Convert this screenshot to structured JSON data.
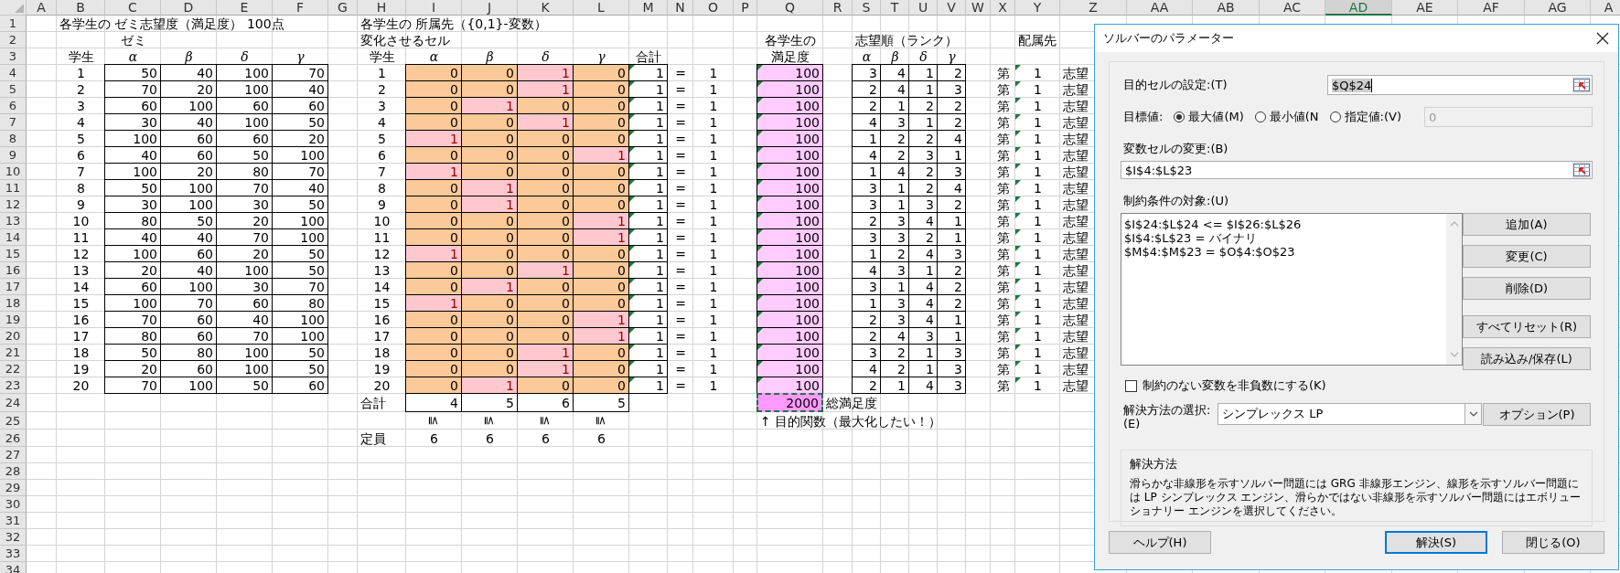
{
  "sheet": {
    "columns": [
      {
        "label": "A",
        "selected": false
      },
      {
        "label": "B",
        "selected": false
      },
      {
        "label": "C",
        "selected": false
      },
      {
        "label": "D",
        "selected": false
      },
      {
        "label": "E",
        "selected": false
      },
      {
        "label": "F",
        "selected": false
      },
      {
        "label": "G",
        "selected": false
      },
      {
        "label": "H",
        "selected": false
      },
      {
        "label": "I",
        "selected": false
      },
      {
        "label": "J",
        "selected": false
      },
      {
        "label": "K",
        "selected": false
      },
      {
        "label": "L",
        "selected": false
      },
      {
        "label": "M",
        "selected": false
      },
      {
        "label": "N",
        "selected": false
      },
      {
        "label": "O",
        "selected": false
      },
      {
        "label": "P",
        "selected": false
      },
      {
        "label": "Q",
        "selected": false
      },
      {
        "label": "R",
        "selected": false
      },
      {
        "label": "S",
        "selected": false
      },
      {
        "label": "T",
        "selected": false
      },
      {
        "label": "U",
        "selected": false
      },
      {
        "label": "V",
        "selected": false
      },
      {
        "label": "W",
        "selected": false
      },
      {
        "label": "X",
        "selected": false
      },
      {
        "label": "Y",
        "selected": false
      },
      {
        "label": "Z",
        "selected": false
      },
      {
        "label": "AA",
        "selected": false
      },
      {
        "label": "AB",
        "selected": false
      },
      {
        "label": "AC",
        "selected": false
      },
      {
        "label": "AD",
        "selected": true
      },
      {
        "label": "AE",
        "selected": false
      },
      {
        "label": "AF",
        "selected": false
      },
      {
        "label": "AG",
        "selected": false
      },
      {
        "label": "A",
        "selected": false
      }
    ],
    "rows": [
      "1",
      "2",
      "3",
      "4",
      "5",
      "6",
      "7",
      "8",
      "9",
      "10",
      "11",
      "12",
      "13",
      "14",
      "15",
      "16",
      "17",
      "18",
      "19",
      "20",
      "21",
      "22",
      "23",
      "24",
      "25",
      "26",
      "27",
      "28",
      "29",
      "30",
      "31",
      "32",
      "33",
      "34"
    ]
  },
  "preferences": {
    "title": "各学生の ゼミ志望度（満足度） 100点",
    "group_label": "ゼミ",
    "student_header": "学生",
    "seminar_headers": [
      "α",
      "β",
      "δ",
      "γ"
    ],
    "rows": [
      {
        "student": "1",
        "scores": [
          "50",
          "40",
          "100",
          "70"
        ]
      },
      {
        "student": "2",
        "scores": [
          "70",
          "20",
          "100",
          "40"
        ]
      },
      {
        "student": "3",
        "scores": [
          "60",
          "100",
          "60",
          "60"
        ]
      },
      {
        "student": "4",
        "scores": [
          "30",
          "40",
          "100",
          "50"
        ]
      },
      {
        "student": "5",
        "scores": [
          "100",
          "60",
          "60",
          "20"
        ]
      },
      {
        "student": "6",
        "scores": [
          "40",
          "60",
          "50",
          "100"
        ]
      },
      {
        "student": "7",
        "scores": [
          "100",
          "20",
          "80",
          "70"
        ]
      },
      {
        "student": "8",
        "scores": [
          "50",
          "100",
          "70",
          "40"
        ]
      },
      {
        "student": "9",
        "scores": [
          "30",
          "100",
          "30",
          "50"
        ]
      },
      {
        "student": "10",
        "scores": [
          "80",
          "50",
          "20",
          "100"
        ]
      },
      {
        "student": "11",
        "scores": [
          "40",
          "40",
          "70",
          "100"
        ]
      },
      {
        "student": "12",
        "scores": [
          "100",
          "60",
          "20",
          "50"
        ]
      },
      {
        "student": "13",
        "scores": [
          "20",
          "40",
          "100",
          "50"
        ]
      },
      {
        "student": "14",
        "scores": [
          "60",
          "100",
          "30",
          "70"
        ]
      },
      {
        "student": "15",
        "scores": [
          "100",
          "70",
          "60",
          "80"
        ]
      },
      {
        "student": "16",
        "scores": [
          "70",
          "60",
          "40",
          "100"
        ]
      },
      {
        "student": "17",
        "scores": [
          "80",
          "60",
          "70",
          "100"
        ]
      },
      {
        "student": "18",
        "scores": [
          "50",
          "80",
          "100",
          "50"
        ]
      },
      {
        "student": "19",
        "scores": [
          "20",
          "60",
          "100",
          "50"
        ]
      },
      {
        "student": "20",
        "scores": [
          "70",
          "100",
          "50",
          "60"
        ]
      }
    ]
  },
  "assignment": {
    "title": "各学生の 所属先（{0,1}-変数）",
    "subtitle": "変化させるセル",
    "student_header": "学生",
    "seminar_headers": [
      "α",
      "β",
      "δ",
      "γ"
    ],
    "sum_header": "合計",
    "rows": [
      {
        "student": "1",
        "values": [
          {
            "value": "0",
            "highlighted": false
          },
          {
            "value": "0",
            "highlighted": false
          },
          {
            "value": "1",
            "highlighted": true
          },
          {
            "value": "0",
            "highlighted": false
          }
        ],
        "sum": "1",
        "sum_flagged": true,
        "relation": "=",
        "target": "1"
      },
      {
        "student": "2",
        "values": [
          {
            "value": "0",
            "highlighted": false
          },
          {
            "value": "0",
            "highlighted": false
          },
          {
            "value": "1",
            "highlighted": true
          },
          {
            "value": "0",
            "highlighted": false
          }
        ],
        "sum": "1",
        "sum_flagged": true,
        "relation": "=",
        "target": "1"
      },
      {
        "student": "3",
        "values": [
          {
            "value": "0",
            "highlighted": false
          },
          {
            "value": "1",
            "highlighted": true
          },
          {
            "value": "0",
            "highlighted": false
          },
          {
            "value": "0",
            "highlighted": false
          }
        ],
        "sum": "1",
        "sum_flagged": true,
        "relation": "=",
        "target": "1"
      },
      {
        "student": "4",
        "values": [
          {
            "value": "0",
            "highlighted": false
          },
          {
            "value": "0",
            "highlighted": false
          },
          {
            "value": "1",
            "highlighted": true
          },
          {
            "value": "0",
            "highlighted": false
          }
        ],
        "sum": "1",
        "sum_flagged": true,
        "relation": "=",
        "target": "1"
      },
      {
        "student": "5",
        "values": [
          {
            "value": "1",
            "highlighted": true
          },
          {
            "value": "0",
            "highlighted": false
          },
          {
            "value": "0",
            "highlighted": false
          },
          {
            "value": "0",
            "highlighted": false
          }
        ],
        "sum": "1",
        "sum_flagged": true,
        "relation": "=",
        "target": "1"
      },
      {
        "student": "6",
        "values": [
          {
            "value": "0",
            "highlighted": false
          },
          {
            "value": "0",
            "highlighted": false
          },
          {
            "value": "0",
            "highlighted": false
          },
          {
            "value": "1",
            "highlighted": true
          }
        ],
        "sum": "1",
        "sum_flagged": true,
        "relation": "=",
        "target": "1"
      },
      {
        "student": "7",
        "values": [
          {
            "value": "1",
            "highlighted": true
          },
          {
            "value": "0",
            "highlighted": false
          },
          {
            "value": "0",
            "highlighted": false
          },
          {
            "value": "0",
            "highlighted": false
          }
        ],
        "sum": "1",
        "sum_flagged": true,
        "relation": "=",
        "target": "1"
      },
      {
        "student": "8",
        "values": [
          {
            "value": "0",
            "highlighted": false
          },
          {
            "value": "1",
            "highlighted": true
          },
          {
            "value": "0",
            "highlighted": false
          },
          {
            "value": "0",
            "highlighted": false
          }
        ],
        "sum": "1",
        "sum_flagged": true,
        "relation": "=",
        "target": "1"
      },
      {
        "student": "9",
        "values": [
          {
            "value": "0",
            "highlighted": false
          },
          {
            "value": "1",
            "highlighted": true
          },
          {
            "value": "0",
            "highlighted": false
          },
          {
            "value": "0",
            "highlighted": false
          }
        ],
        "sum": "1",
        "sum_flagged": true,
        "relation": "=",
        "target": "1"
      },
      {
        "student": "10",
        "values": [
          {
            "value": "0",
            "highlighted": false
          },
          {
            "value": "0",
            "highlighted": false
          },
          {
            "value": "0",
            "highlighted": false
          },
          {
            "value": "1",
            "highlighted": true
          }
        ],
        "sum": "1",
        "sum_flagged": true,
        "relation": "=",
        "target": "1"
      },
      {
        "student": "11",
        "values": [
          {
            "value": "0",
            "highlighted": false
          },
          {
            "value": "0",
            "highlighted": false
          },
          {
            "value": "0",
            "highlighted": false
          },
          {
            "value": "1",
            "highlighted": true
          }
        ],
        "sum": "1",
        "sum_flagged": true,
        "relation": "=",
        "target": "1"
      },
      {
        "student": "12",
        "values": [
          {
            "value": "1",
            "highlighted": true
          },
          {
            "value": "0",
            "highlighted": false
          },
          {
            "value": "0",
            "highlighted": false
          },
          {
            "value": "0",
            "highlighted": false
          }
        ],
        "sum": "1",
        "sum_flagged": true,
        "relation": "=",
        "target": "1"
      },
      {
        "student": "13",
        "values": [
          {
            "value": "0",
            "highlighted": false
          },
          {
            "value": "0",
            "highlighted": false
          },
          {
            "value": "1",
            "highlighted": true
          },
          {
            "value": "0",
            "highlighted": false
          }
        ],
        "sum": "1",
        "sum_flagged": true,
        "relation": "=",
        "target": "1"
      },
      {
        "student": "14",
        "values": [
          {
            "value": "0",
            "highlighted": false
          },
          {
            "value": "1",
            "highlighted": true
          },
          {
            "value": "0",
            "highlighted": false
          },
          {
            "value": "0",
            "highlighted": false
          }
        ],
        "sum": "1",
        "sum_flagged": true,
        "relation": "=",
        "target": "1"
      },
      {
        "student": "15",
        "values": [
          {
            "value": "1",
            "highlighted": true
          },
          {
            "value": "0",
            "highlighted": false
          },
          {
            "value": "0",
            "highlighted": false
          },
          {
            "value": "0",
            "highlighted": false
          }
        ],
        "sum": "1",
        "sum_flagged": true,
        "relation": "=",
        "target": "1"
      },
      {
        "student": "16",
        "values": [
          {
            "value": "0",
            "highlighted": false
          },
          {
            "value": "0",
            "highlighted": false
          },
          {
            "value": "0",
            "highlighted": false
          },
          {
            "value": "1",
            "highlighted": true
          }
        ],
        "sum": "1",
        "sum_flagged": true,
        "relation": "=",
        "target": "1"
      },
      {
        "student": "17",
        "values": [
          {
            "value": "0",
            "highlighted": false
          },
          {
            "value": "0",
            "highlighted": false
          },
          {
            "value": "0",
            "highlighted": false
          },
          {
            "value": "1",
            "highlighted": true
          }
        ],
        "sum": "1",
        "sum_flagged": true,
        "relation": "=",
        "target": "1"
      },
      {
        "student": "18",
        "values": [
          {
            "value": "0",
            "highlighted": false
          },
          {
            "value": "0",
            "highlighted": false
          },
          {
            "value": "1",
            "highlighted": true
          },
          {
            "value": "0",
            "highlighted": false
          }
        ],
        "sum": "1",
        "sum_flagged": true,
        "relation": "=",
        "target": "1"
      },
      {
        "student": "19",
        "values": [
          {
            "value": "0",
            "highlighted": false
          },
          {
            "value": "0",
            "highlighted": false
          },
          {
            "value": "1",
            "highlighted": true
          },
          {
            "value": "0",
            "highlighted": false
          }
        ],
        "sum": "1",
        "sum_flagged": true,
        "relation": "=",
        "target": "1"
      },
      {
        "student": "20",
        "values": [
          {
            "value": "0",
            "highlighted": false
          },
          {
            "value": "1",
            "highlighted": true
          },
          {
            "value": "0",
            "highlighted": false
          },
          {
            "value": "0",
            "highlighted": false
          }
        ],
        "sum": "1",
        "sum_flagged": true,
        "relation": "=",
        "target": "1"
      }
    ],
    "total_label": "合計",
    "totals": [
      "4",
      "5",
      "6",
      "5"
    ],
    "capacity_relations": [
      "≦",
      "≦",
      "≦",
      "≦"
    ],
    "capacity_label": "定員",
    "capacities": [
      "6",
      "6",
      "6",
      "6"
    ]
  },
  "satisfaction": {
    "header": [
      "各学生の",
      "満足度"
    ],
    "values": [
      {
        "value": "100",
        "flagged": true
      },
      {
        "value": "100",
        "flagged": true
      },
      {
        "value": "100",
        "flagged": true
      },
      {
        "value": "100",
        "flagged": true
      },
      {
        "value": "100",
        "flagged": true
      },
      {
        "value": "100",
        "flagged": true
      },
      {
        "value": "100",
        "flagged": true
      },
      {
        "value": "100",
        "flagged": true
      },
      {
        "value": "100",
        "flagged": true
      },
      {
        "value": "100",
        "flagged": true
      },
      {
        "value": "100",
        "flagged": true
      },
      {
        "value": "100",
        "flagged": true
      },
      {
        "value": "100",
        "flagged": true
      },
      {
        "value": "100",
        "flagged": true
      },
      {
        "value": "100",
        "flagged": true
      },
      {
        "value": "100",
        "flagged": true
      },
      {
        "value": "100",
        "flagged": true
      },
      {
        "value": "100",
        "flagged": true
      },
      {
        "value": "100",
        "flagged": true
      },
      {
        "value": "100",
        "flagged": true
      }
    ],
    "total": "2000",
    "total_marquee": true,
    "total_label": "総満足度",
    "note": "↑ 目的関数（最大化したい！）"
  },
  "ranks": {
    "title": "志望順（ランク）",
    "headers": [
      "α",
      "β",
      "δ",
      "γ"
    ],
    "rows": [
      [
        "3",
        "4",
        "1",
        "2"
      ],
      [
        "2",
        "4",
        "1",
        "3"
      ],
      [
        "2",
        "1",
        "2",
        "2"
      ],
      [
        "4",
        "3",
        "1",
        "2"
      ],
      [
        "1",
        "2",
        "2",
        "4"
      ],
      [
        "4",
        "2",
        "3",
        "1"
      ],
      [
        "1",
        "4",
        "2",
        "3"
      ],
      [
        "3",
        "1",
        "2",
        "4"
      ],
      [
        "3",
        "1",
        "3",
        "2"
      ],
      [
        "2",
        "3",
        "4",
        "1"
      ],
      [
        "3",
        "3",
        "2",
        "1"
      ],
      [
        "1",
        "2",
        "4",
        "3"
      ],
      [
        "4",
        "3",
        "1",
        "2"
      ],
      [
        "3",
        "1",
        "4",
        "2"
      ],
      [
        "1",
        "3",
        "4",
        "2"
      ],
      [
        "2",
        "3",
        "4",
        "1"
      ],
      [
        "2",
        "4",
        "3",
        "1"
      ],
      [
        "3",
        "2",
        "1",
        "3"
      ],
      [
        "4",
        "2",
        "1",
        "3"
      ],
      [
        "2",
        "1",
        "4",
        "3"
      ]
    ]
  },
  "placement": {
    "title": "配属先",
    "rows": [
      {
        "prefix": "第",
        "rank": "1",
        "suffix": "志望",
        "flagged": true
      },
      {
        "prefix": "第",
        "rank": "1",
        "suffix": "志望",
        "flagged": true
      },
      {
        "prefix": "第",
        "rank": "1",
        "suffix": "志望",
        "flagged": true
      },
      {
        "prefix": "第",
        "rank": "1",
        "suffix": "志望",
        "flagged": true
      },
      {
        "prefix": "第",
        "rank": "1",
        "suffix": "志望",
        "flagged": true
      },
      {
        "prefix": "第",
        "rank": "1",
        "suffix": "志望",
        "flagged": true
      },
      {
        "prefix": "第",
        "rank": "1",
        "suffix": "志望",
        "flagged": true
      },
      {
        "prefix": "第",
        "rank": "1",
        "suffix": "志望",
        "flagged": true
      },
      {
        "prefix": "第",
        "rank": "1",
        "suffix": "志望",
        "flagged": true
      },
      {
        "prefix": "第",
        "rank": "1",
        "suffix": "志望",
        "flagged": true
      },
      {
        "prefix": "第",
        "rank": "1",
        "suffix": "志望",
        "flagged": true
      },
      {
        "prefix": "第",
        "rank": "1",
        "suffix": "志望",
        "flagged": true
      },
      {
        "prefix": "第",
        "rank": "1",
        "suffix": "志望",
        "flagged": true
      },
      {
        "prefix": "第",
        "rank": "1",
        "suffix": "志望",
        "flagged": true
      },
      {
        "prefix": "第",
        "rank": "1",
        "suffix": "志望",
        "flagged": true
      },
      {
        "prefix": "第",
        "rank": "1",
        "suffix": "志望",
        "flagged": true
      },
      {
        "prefix": "第",
        "rank": "1",
        "suffix": "志望",
        "flagged": true
      },
      {
        "prefix": "第",
        "rank": "1",
        "suffix": "志望",
        "flagged": true
      },
      {
        "prefix": "第",
        "rank": "1",
        "suffix": "志望",
        "flagged": true
      },
      {
        "prefix": "第",
        "rank": "1",
        "suffix": "志望",
        "flagged": true
      }
    ]
  },
  "solver_dialog": {
    "title": "ソルバーのパラメーター",
    "objective": {
      "label": "目的セルの設定:(T)",
      "value": "$Q$24",
      "text_selected": true
    },
    "target": {
      "label": "目標値:",
      "options": [
        {
          "label": "最大値(M)",
          "selected": true
        },
        {
          "label": "最小値(N",
          "selected": false
        },
        {
          "label": "指定値:(V)",
          "selected": false
        }
      ],
      "value": "0",
      "disabled": true
    },
    "variables": {
      "label": "変数セルの変更:(B)",
      "value": "$I$4:$L$23"
    },
    "constraints": {
      "label": "制約条件の対象:(U)",
      "items": [
        "$I$24:$L$24 <= $I$26:$L$26",
        "$I$4:$L$23 = バイナリ",
        "$M$4:$M$23 = $O$4:$O$23"
      ],
      "buttons": [
        "追加(A)",
        "変更(C)",
        "削除(D)",
        "すべてリセット(R)",
        "読み込み/保存(L)"
      ]
    },
    "nonnegative": {
      "label": "制約のない変数を非負数にする(K)",
      "checked": false
    },
    "method": {
      "label": "解決方法の選択:(E)",
      "value": "シンプレックス LP",
      "options_button": "オプション(P)"
    },
    "description": {
      "title": "解決方法",
      "text": "滑らかな非線形を示すソルバー問題には GRG 非線形エンジン、線形を示すソルバー問題には LP シンプレックス エンジン、滑らかではない非線形を示すソルバー問題にはエボリューショナリー エンジンを選択してください。"
    },
    "footer_buttons": [
      {
        "label": "ヘルプ(H)",
        "default": false
      },
      {
        "label": "解決(S)",
        "default": true
      },
      {
        "label": "閉じる(O)",
        "default": false
      }
    ]
  }
}
